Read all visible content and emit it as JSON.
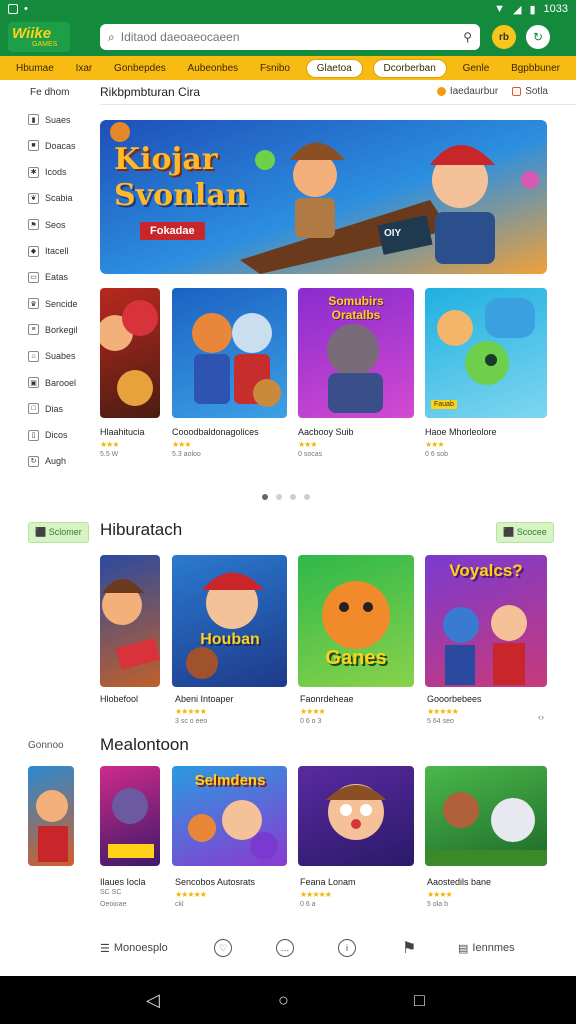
{
  "status_bar": {
    "time": "1033",
    "left_icons": [
      "square-icon",
      "dot-icon"
    ],
    "right_icons": [
      "wifi-icon",
      "signal-icon",
      "battery-icon"
    ]
  },
  "app": {
    "logo_text": "Wiike",
    "logo_sub": "GAMES"
  },
  "search": {
    "placeholder": "Iditaod daeoaeocaeen"
  },
  "header_buttons": {
    "coin_label": "rb",
    "profile_icon": "refresh-icon"
  },
  "categories": [
    "Hbumae",
    "Ixar",
    "Gonbepdes",
    "Aubeonbes",
    "Fsnibo",
    "Glaetoa",
    "Dcorberban",
    "Genle",
    "Bgpbbuner"
  ],
  "active_category_index": 6,
  "sidebar": {
    "title": "Fe dhom",
    "items": [
      {
        "label": "Suaes",
        "icon": "tag-icon"
      },
      {
        "label": "Doacas",
        "icon": "square-icon"
      },
      {
        "label": "Icods",
        "icon": "pinwheel-icon"
      },
      {
        "label": "Scabia",
        "icon": "leaf-icon"
      },
      {
        "label": "Seos",
        "icon": "flag-icon"
      },
      {
        "label": "Itacell",
        "icon": "gem-icon"
      },
      {
        "label": "Eatas",
        "icon": "folder-icon"
      },
      {
        "label": "Sencide",
        "icon": "trophy-icon"
      },
      {
        "label": "Borkegil",
        "icon": "list-icon"
      },
      {
        "label": "Suabes",
        "icon": "shield-icon"
      },
      {
        "label": "Barooel",
        "icon": "book-icon"
      },
      {
        "label": "Dias",
        "icon": "page-icon"
      },
      {
        "label": "Dicos",
        "icon": "doc-icon"
      },
      {
        "label": "Augh",
        "icon": "cycle-icon"
      }
    ]
  },
  "top_section": {
    "title": "Rikbpmbturan Cira",
    "links": [
      {
        "label": "Iaedaurbur"
      },
      {
        "label": "Sotla"
      }
    ]
  },
  "hero": {
    "title_line1": "Kiojar",
    "title_line2": "Svonlan",
    "badge": "Fokadae",
    "ticket": "OIY"
  },
  "featured": [
    {
      "title": "Hlaahitucia",
      "stars": "★★★",
      "meta": "5.5 W"
    },
    {
      "title": "Cooodbaldonagolices",
      "stars": "★★★",
      "meta": "5.3 aoloo",
      "art_text": ""
    },
    {
      "title": "Aacbooy Suib",
      "stars": "★★★",
      "meta": "0 socas",
      "art_text": "Somubirs Oratalbs"
    },
    {
      "title": "Haoe Mhorleolore",
      "stars": "★★★",
      "meta": "0 6 sob",
      "art_text": "Fauab"
    }
  ],
  "carousel": {
    "page_count": 4,
    "active_page": 0
  },
  "section2": {
    "title": "Hiburatach",
    "left_pill": "Sclomer",
    "right_pill": "Scocee",
    "games": [
      {
        "title": "Hlobefool",
        "stars": "",
        "meta": ""
      },
      {
        "title": "Abeni Intoaper",
        "stars": "★★★★★",
        "meta": "3 sc o eeo",
        "art_text": "Houban"
      },
      {
        "title": "Faonrdeheae",
        "stars": "★★★★",
        "meta": "0 6 o 3",
        "art_text": "Ganes"
      },
      {
        "title": "Gooorbebees",
        "stars": "★★★★★",
        "meta": "5 64 seo",
        "art_text": "Voyalcs?"
      }
    ]
  },
  "section3": {
    "title": "Mealontoon",
    "left_label": "Gonnoo",
    "games": [
      {
        "title": "Ilaues Iocla",
        "stars": "",
        "meta": "Oeoioae",
        "meta2": "SC SC"
      },
      {
        "title": "Sencobos Autosrats",
        "stars": "★★★★★",
        "meta": "ckl",
        "art_text": "Selmdens"
      },
      {
        "title": "Feana Lonam",
        "stars": "★★★★★",
        "meta": "0 6 a"
      },
      {
        "title": "Aaostedils bane",
        "stars": "★★★★",
        "meta": "5 ola b"
      }
    ]
  },
  "bottom_nav": {
    "left_label": "Monoesplo",
    "right_label": "Iennmes"
  },
  "colors": {
    "primary_green": "#148a3c",
    "accent_yellow": "#f8bb13",
    "pill_green": "#d6f3c3"
  }
}
